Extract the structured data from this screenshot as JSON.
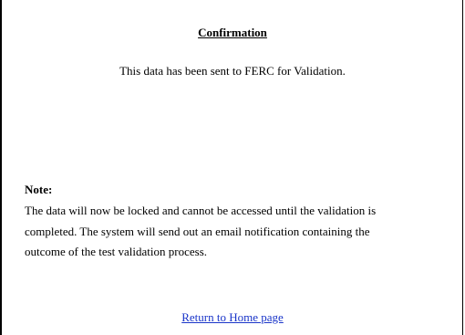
{
  "confirmation": {
    "title": "Confirmation",
    "message": "This data has been sent to FERC for Validation."
  },
  "note": {
    "heading": "Note:",
    "lines": [
      "The data will now be locked and cannot be accessed until the validation is",
      "completed. The system will send out an email notification containing the",
      "outcome of the test validation process."
    ]
  },
  "links": {
    "return_home": "Return to Home page"
  },
  "colors": {
    "link": "#1a35c9",
    "text": "#000000",
    "background": "#ffffff"
  }
}
